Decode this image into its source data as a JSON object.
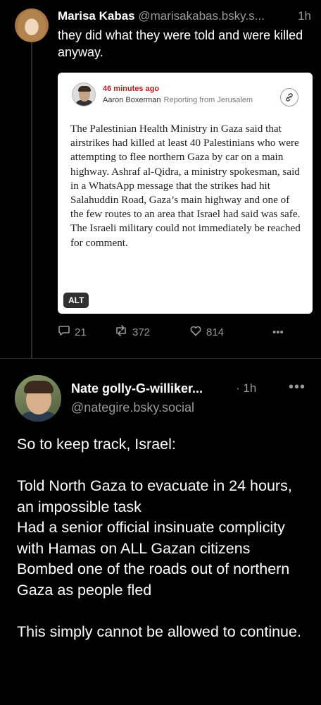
{
  "post1": {
    "author_name": "Marisa Kabas",
    "handle": "@marisakabas.bsky.s...",
    "time": "1h",
    "text": "they did what they were told and were killed anyway.",
    "embed": {
      "time_ago": "46 minutes ago",
      "author": "Aaron Boxerman",
      "reporting_note": "Reporting from Jerusalem",
      "body": "The Palestinian Health Ministry in Gaza said that airstrikes had killed at least 40 Palestinians who were attempting to flee northern Gaza by car on a main highway. Ashraf al-Qidra, a ministry spokesman, said in a WhatsApp message that the strikes had hit Salahuddin Road, Gaza’s main highway and one of the few routes to an area that Israel had said was safe. The Israeli military could not immediately be reached for comment.",
      "alt_badge": "ALT"
    },
    "actions": {
      "replies": "21",
      "reposts": "372",
      "likes": "814",
      "more": "•••"
    }
  },
  "post2": {
    "author_name": "Nate golly-G-williker...",
    "separator": "·",
    "time": "1h",
    "handle": "@nategire.bsky.social",
    "more": "•••",
    "lines": {
      "intro": "So to keep track, Israel:",
      "item1": "Told North Gaza to evacuate in 24 hours, an impossible task",
      "item2": "Had a senior official insinuate complicity with Hamas on ALL Gazan citizens",
      "item3": "Bombed one of the roads out of northern Gaza as people fled",
      "closing": "This simply cannot be allowed to continue."
    }
  },
  "colors": {
    "background": "#000000",
    "muted_text": "#9a9a9a",
    "embed_time_red": "#b21e1e"
  },
  "icons": [
    "reply-icon",
    "repost-icon",
    "like-icon",
    "link-icon",
    "more-icon"
  ]
}
